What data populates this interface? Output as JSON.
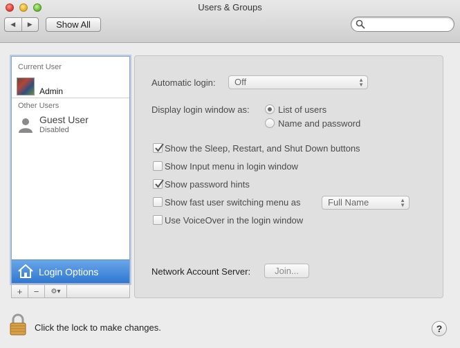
{
  "window": {
    "title": "Users & Groups"
  },
  "toolbar": {
    "back_glyph": "◀",
    "forward_glyph": "▶",
    "show_all_label": "Show All",
    "search_placeholder": "",
    "search_value": ""
  },
  "sidebar": {
    "current_user_label": "Current User",
    "current_user_name": "Admin",
    "other_users_label": "Other Users",
    "guest_name": "Guest User",
    "guest_status": "Disabled",
    "login_options_label": "Login Options",
    "add_glyph": "+",
    "remove_glyph": "−",
    "gear_glyph": "⚙▾"
  },
  "panel": {
    "automatic_login_label": "Automatic login:",
    "automatic_login_value": "Off",
    "display_login_label": "Display login window as:",
    "radio_list_label": "List of users",
    "radio_name_label": "Name and password",
    "radio_selected": "list",
    "checks": [
      {
        "label": "Show the Sleep, Restart, and Shut Down buttons",
        "checked": true
      },
      {
        "label": "Show Input menu in login window",
        "checked": false
      },
      {
        "label": "Show password hints",
        "checked": true
      },
      {
        "label": "Show fast user switching menu as",
        "checked": false
      },
      {
        "label": "Use VoiceOver in the login window",
        "checked": false
      }
    ],
    "fast_switch_value": "Full Name",
    "network_server_label": "Network Account Server:",
    "join_label": "Join..."
  },
  "footer": {
    "lock_text": "Click the lock to make changes.",
    "help_glyph": "?"
  },
  "colors": {
    "selection": "#2f78d1",
    "panel_bg": "#e0e0e0",
    "window_bg": "#ececec"
  }
}
